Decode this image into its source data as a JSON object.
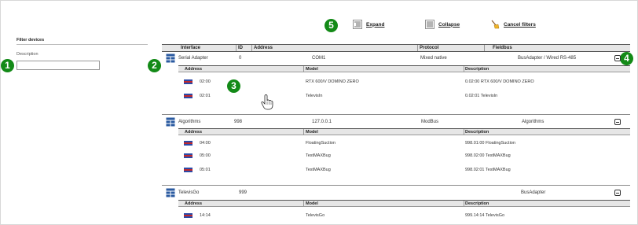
{
  "filter": {
    "title": "Filter devices",
    "description_label": "Description",
    "description_value": ""
  },
  "badges": [
    "1",
    "2",
    "3",
    "4",
    "5"
  ],
  "toolbar": {
    "expand_label": "Expand",
    "collapse_label": "Collapse",
    "cancel_filters_label": "Cancel filters"
  },
  "grid": {
    "columns": [
      "Interface",
      "ID",
      "Address",
      "Protocol",
      "Fieldbus"
    ],
    "sub_columns": [
      "Address",
      "Model",
      "Description"
    ],
    "devices": [
      {
        "interface": "Serial Adapter",
        "id": "0",
        "address": "COM1",
        "protocol": "Mixed native",
        "fieldbus": "BusAdapter / Wired RS-485",
        "children": [
          {
            "address": "02:00",
            "model": "RTX 600/V DOMINO ZERO",
            "description": "0.02:00 RTX 600/V DOMINO ZERO"
          },
          {
            "address": "02:01",
            "model": "TelevisIn",
            "description": "0.02:01 TelevisIn"
          }
        ]
      },
      {
        "interface": "Algorithms",
        "id": "998",
        "address": "127.0.0.1",
        "protocol": "ModBus",
        "fieldbus": "Algorithms",
        "children": [
          {
            "address": "04:00",
            "model": "FloatingSuction",
            "description": "998.01:00 FloatingSuction"
          },
          {
            "address": "05:00",
            "model": "TestMAXBug",
            "description": "998.02:00 TestMAXBug"
          },
          {
            "address": "05:01",
            "model": "TestMAXBug",
            "description": "998.02:01 TestMAXBug"
          }
        ]
      },
      {
        "interface": "TelevisGo",
        "id": "999",
        "address": "",
        "protocol": "",
        "fieldbus": "BusAdapter",
        "children": [
          {
            "address": "14:14",
            "model": "TelevisGo",
            "description": "999.14:14 TelevisGo"
          }
        ]
      }
    ]
  },
  "icons": {
    "expand": "expand-list-icon",
    "collapse": "collapse-list-icon",
    "cancel_filters": "broom-icon",
    "device": "device-grid-icon",
    "toggle": "collapse-toggle-icon",
    "flag": "device-flag-icon",
    "cursor": "hand-pointer-icon"
  },
  "colors": {
    "badge": "#138a17",
    "header_bg": "#e6e6e6",
    "device_icon": "#2a5aa0",
    "flag_blue": "#2b4aa8",
    "flag_red": "#c0282d"
  }
}
